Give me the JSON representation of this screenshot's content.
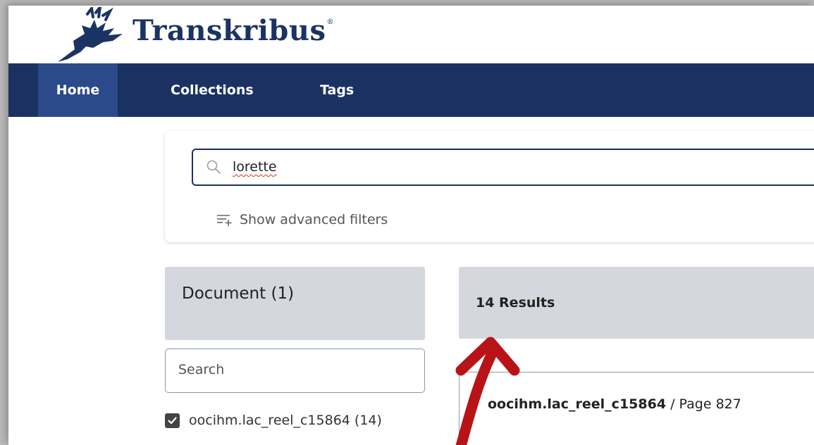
{
  "brand": {
    "name": "Transkribus",
    "mark": "®"
  },
  "nav": {
    "items": [
      {
        "label": "Home"
      },
      {
        "label": "Collections"
      },
      {
        "label": "Tags"
      }
    ]
  },
  "search": {
    "value": "lorette",
    "advanced_label": "Show advanced filters"
  },
  "facets": {
    "document_title": "Document (1)",
    "search_placeholder": "Search",
    "items": [
      {
        "label": "oocihm.lac_reel_c15864 (14)",
        "checked": true
      }
    ]
  },
  "results": {
    "count_label": "14 Results",
    "items": [
      {
        "doc": "oocihm.lac_reel_c15864",
        "page": " / Page 827"
      }
    ]
  },
  "annotation": {
    "arrow_color": "#b81417"
  },
  "colors": {
    "navy": "#1b3161",
    "nav_active": "#2b4a8b",
    "panel": "#d4d7dd"
  }
}
